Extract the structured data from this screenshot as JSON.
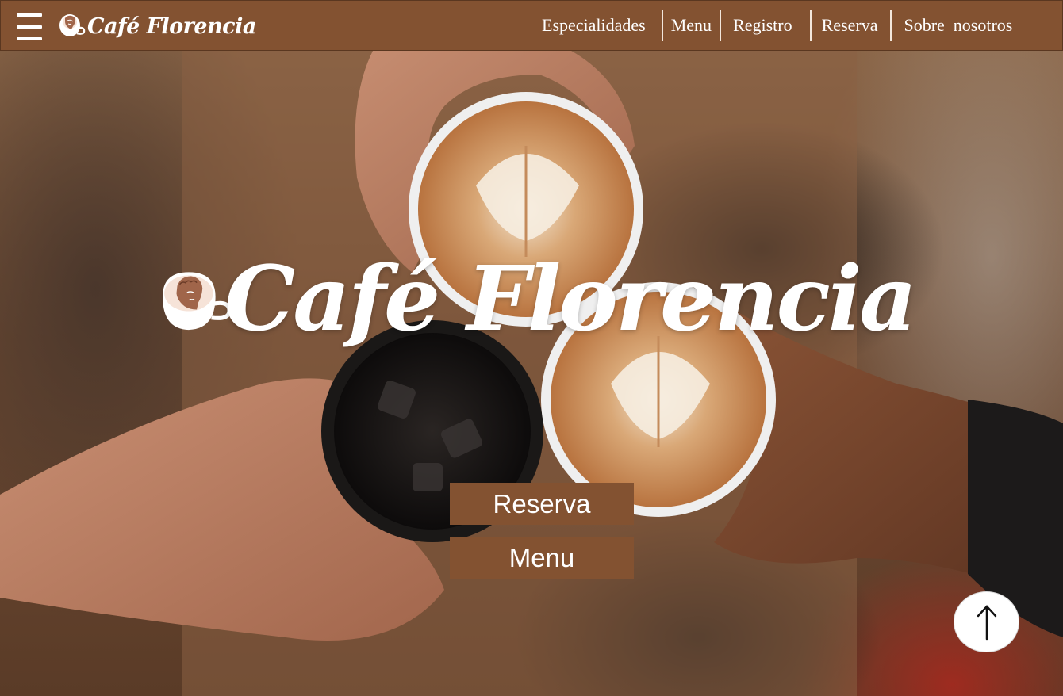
{
  "brand": {
    "name": "Café Florencia",
    "logo_icon": "cup-with-david-head-icon"
  },
  "nav": {
    "menu_icon": "hamburger-menu-icon",
    "items": [
      {
        "label": "Especialidades"
      },
      {
        "label": "Menu"
      },
      {
        "label": "Registro"
      },
      {
        "label": "Reserva"
      },
      {
        "label": "Sobre  nosotros"
      }
    ]
  },
  "hero": {
    "title": "Café Florencia",
    "background": "photo of hands toasting coffee cups",
    "buttons": {
      "reserva": "Reserva",
      "menu": "Menu"
    },
    "scroll_top_icon": "arrow-up-icon"
  },
  "colors": {
    "brand_brown": "#835231",
    "text_light": "#ffffff"
  }
}
